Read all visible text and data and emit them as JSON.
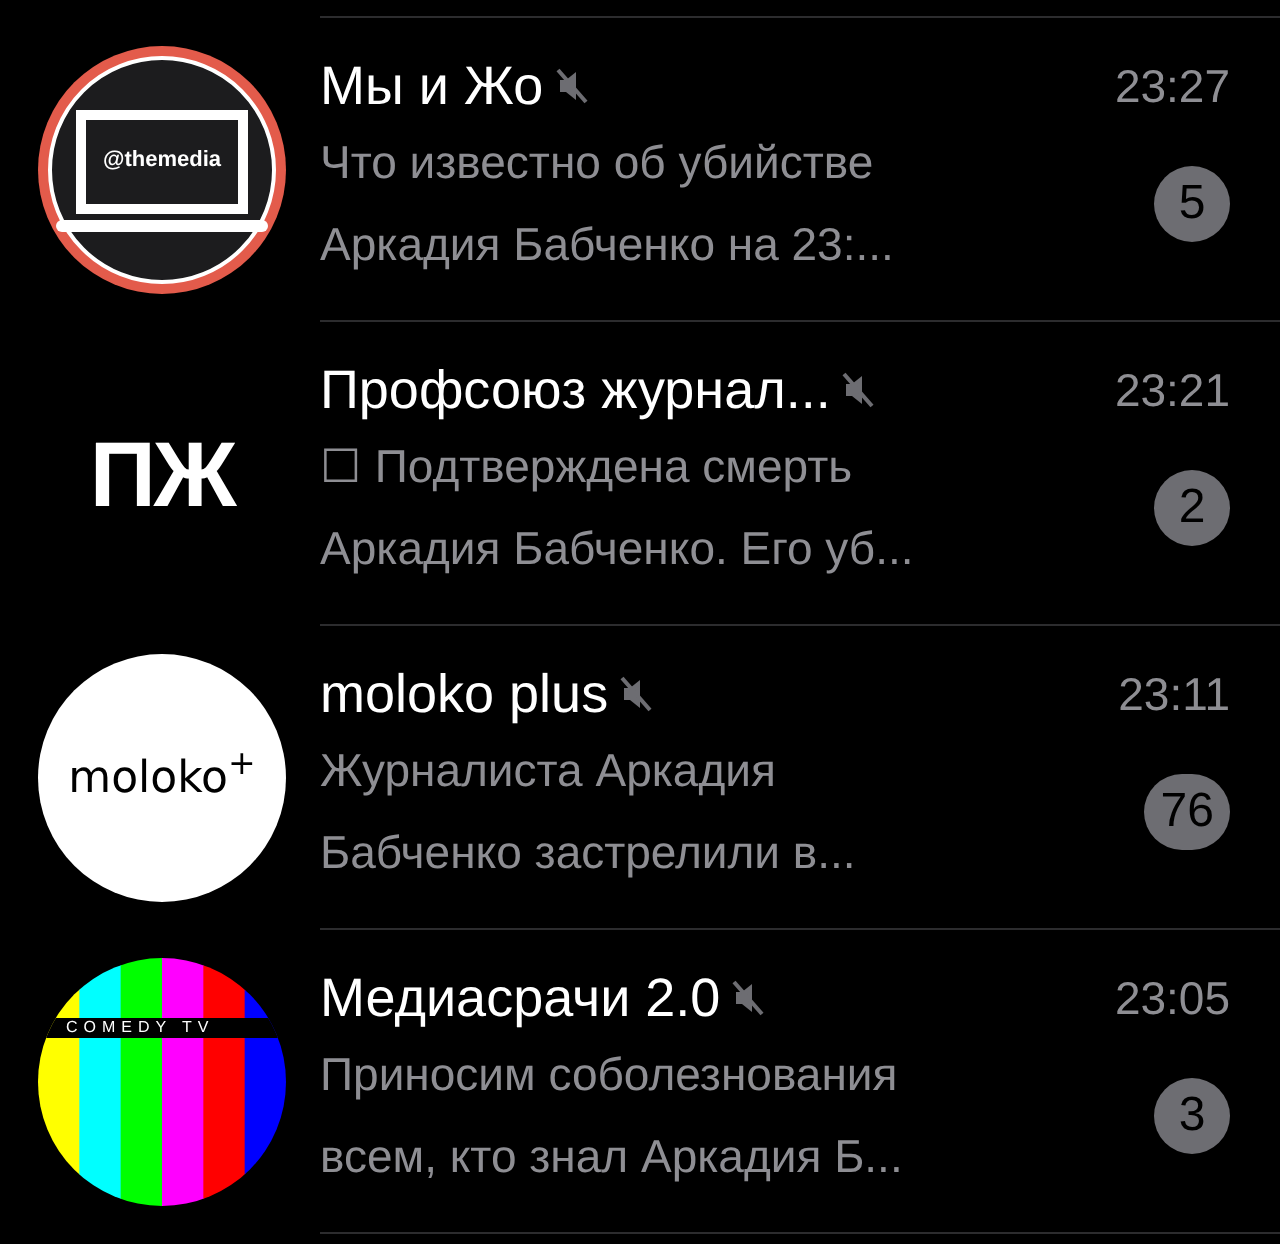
{
  "chats": [
    {
      "title": "Мы и Жо",
      "muted": true,
      "time": "23:27",
      "preview_lines": [
        "Что известно об убийстве",
        "Аркадия Бабченко на 23:..."
      ],
      "unread": "5",
      "avatar": {
        "kind": "laptop",
        "text": "@themedia"
      }
    },
    {
      "title": "Профсоюз журнал...",
      "muted": true,
      "time": "23:21",
      "preview_lines": [
        "☐ Подтверждена смерть",
        "Аркадия Бабченко. Его уб..."
      ],
      "unread": "2",
      "avatar": {
        "kind": "letters",
        "text": "ПЖ"
      }
    },
    {
      "title": "moloko plus",
      "muted": true,
      "time": "23:11",
      "preview_lines": [
        "Журналиста Аркадия",
        "Бабченко застрелили в..."
      ],
      "unread": "76",
      "avatar": {
        "kind": "white",
        "text": "moloko$^{+}$"
      }
    },
    {
      "title": "Медиасрачи 2.0",
      "muted": true,
      "time": "23:05",
      "preview_lines": [
        "Приносим соболезнования",
        "всем, кто знал Аркадия Б..."
      ],
      "unread": "3",
      "avatar": {
        "kind": "bars",
        "text": "COMEDY TV"
      }
    }
  ]
}
